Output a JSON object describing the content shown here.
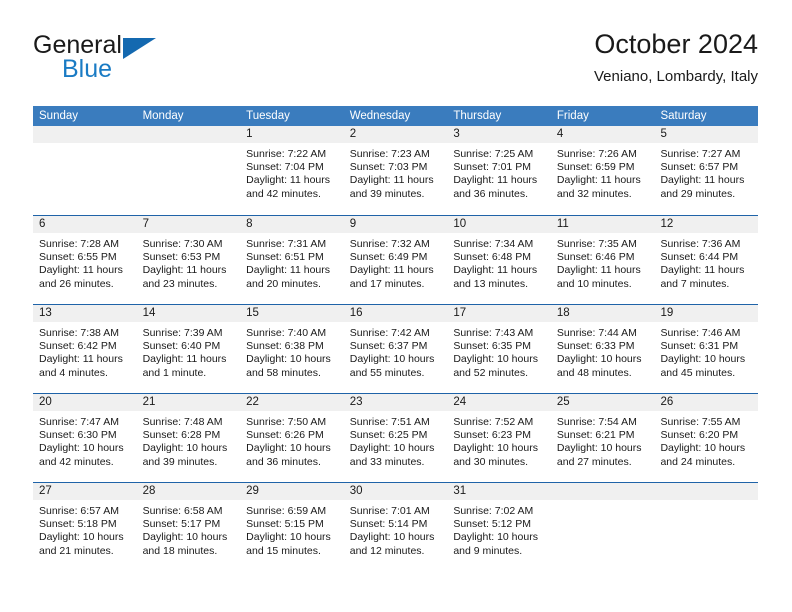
{
  "brand": {
    "name_part1": "General",
    "name_part2": "Blue",
    "accent_color": "#1a7bc4",
    "triangle_color": "#1469b0"
  },
  "header": {
    "title": "October 2024",
    "subtitle": "Veniano, Lombardy, Italy"
  },
  "calendar": {
    "header_bg": "#3a7cbe",
    "separator_color": "#1f63a8",
    "day_band_bg": "#f0f0f0",
    "weekdays": [
      "Sunday",
      "Monday",
      "Tuesday",
      "Wednesday",
      "Thursday",
      "Friday",
      "Saturday"
    ],
    "weeks": [
      [
        {
          "day": ""
        },
        {
          "day": ""
        },
        {
          "day": "1",
          "sunrise": "Sunrise: 7:22 AM",
          "sunset": "Sunset: 7:04 PM",
          "daylight": "Daylight: 11 hours and 42 minutes."
        },
        {
          "day": "2",
          "sunrise": "Sunrise: 7:23 AM",
          "sunset": "Sunset: 7:03 PM",
          "daylight": "Daylight: 11 hours and 39 minutes."
        },
        {
          "day": "3",
          "sunrise": "Sunrise: 7:25 AM",
          "sunset": "Sunset: 7:01 PM",
          "daylight": "Daylight: 11 hours and 36 minutes."
        },
        {
          "day": "4",
          "sunrise": "Sunrise: 7:26 AM",
          "sunset": "Sunset: 6:59 PM",
          "daylight": "Daylight: 11 hours and 32 minutes."
        },
        {
          "day": "5",
          "sunrise": "Sunrise: 7:27 AM",
          "sunset": "Sunset: 6:57 PM",
          "daylight": "Daylight: 11 hours and 29 minutes."
        }
      ],
      [
        {
          "day": "6",
          "sunrise": "Sunrise: 7:28 AM",
          "sunset": "Sunset: 6:55 PM",
          "daylight": "Daylight: 11 hours and 26 minutes."
        },
        {
          "day": "7",
          "sunrise": "Sunrise: 7:30 AM",
          "sunset": "Sunset: 6:53 PM",
          "daylight": "Daylight: 11 hours and 23 minutes."
        },
        {
          "day": "8",
          "sunrise": "Sunrise: 7:31 AM",
          "sunset": "Sunset: 6:51 PM",
          "daylight": "Daylight: 11 hours and 20 minutes."
        },
        {
          "day": "9",
          "sunrise": "Sunrise: 7:32 AM",
          "sunset": "Sunset: 6:49 PM",
          "daylight": "Daylight: 11 hours and 17 minutes."
        },
        {
          "day": "10",
          "sunrise": "Sunrise: 7:34 AM",
          "sunset": "Sunset: 6:48 PM",
          "daylight": "Daylight: 11 hours and 13 minutes."
        },
        {
          "day": "11",
          "sunrise": "Sunrise: 7:35 AM",
          "sunset": "Sunset: 6:46 PM",
          "daylight": "Daylight: 11 hours and 10 minutes."
        },
        {
          "day": "12",
          "sunrise": "Sunrise: 7:36 AM",
          "sunset": "Sunset: 6:44 PM",
          "daylight": "Daylight: 11 hours and 7 minutes."
        }
      ],
      [
        {
          "day": "13",
          "sunrise": "Sunrise: 7:38 AM",
          "sunset": "Sunset: 6:42 PM",
          "daylight": "Daylight: 11 hours and 4 minutes."
        },
        {
          "day": "14",
          "sunrise": "Sunrise: 7:39 AM",
          "sunset": "Sunset: 6:40 PM",
          "daylight": "Daylight: 11 hours and 1 minute."
        },
        {
          "day": "15",
          "sunrise": "Sunrise: 7:40 AM",
          "sunset": "Sunset: 6:38 PM",
          "daylight": "Daylight: 10 hours and 58 minutes."
        },
        {
          "day": "16",
          "sunrise": "Sunrise: 7:42 AM",
          "sunset": "Sunset: 6:37 PM",
          "daylight": "Daylight: 10 hours and 55 minutes."
        },
        {
          "day": "17",
          "sunrise": "Sunrise: 7:43 AM",
          "sunset": "Sunset: 6:35 PM",
          "daylight": "Daylight: 10 hours and 52 minutes."
        },
        {
          "day": "18",
          "sunrise": "Sunrise: 7:44 AM",
          "sunset": "Sunset: 6:33 PM",
          "daylight": "Daylight: 10 hours and 48 minutes."
        },
        {
          "day": "19",
          "sunrise": "Sunrise: 7:46 AM",
          "sunset": "Sunset: 6:31 PM",
          "daylight": "Daylight: 10 hours and 45 minutes."
        }
      ],
      [
        {
          "day": "20",
          "sunrise": "Sunrise: 7:47 AM",
          "sunset": "Sunset: 6:30 PM",
          "daylight": "Daylight: 10 hours and 42 minutes."
        },
        {
          "day": "21",
          "sunrise": "Sunrise: 7:48 AM",
          "sunset": "Sunset: 6:28 PM",
          "daylight": "Daylight: 10 hours and 39 minutes."
        },
        {
          "day": "22",
          "sunrise": "Sunrise: 7:50 AM",
          "sunset": "Sunset: 6:26 PM",
          "daylight": "Daylight: 10 hours and 36 minutes."
        },
        {
          "day": "23",
          "sunrise": "Sunrise: 7:51 AM",
          "sunset": "Sunset: 6:25 PM",
          "daylight": "Daylight: 10 hours and 33 minutes."
        },
        {
          "day": "24",
          "sunrise": "Sunrise: 7:52 AM",
          "sunset": "Sunset: 6:23 PM",
          "daylight": "Daylight: 10 hours and 30 minutes."
        },
        {
          "day": "25",
          "sunrise": "Sunrise: 7:54 AM",
          "sunset": "Sunset: 6:21 PM",
          "daylight": "Daylight: 10 hours and 27 minutes."
        },
        {
          "day": "26",
          "sunrise": "Sunrise: 7:55 AM",
          "sunset": "Sunset: 6:20 PM",
          "daylight": "Daylight: 10 hours and 24 minutes."
        }
      ],
      [
        {
          "day": "27",
          "sunrise": "Sunrise: 6:57 AM",
          "sunset": "Sunset: 5:18 PM",
          "daylight": "Daylight: 10 hours and 21 minutes."
        },
        {
          "day": "28",
          "sunrise": "Sunrise: 6:58 AM",
          "sunset": "Sunset: 5:17 PM",
          "daylight": "Daylight: 10 hours and 18 minutes."
        },
        {
          "day": "29",
          "sunrise": "Sunrise: 6:59 AM",
          "sunset": "Sunset: 5:15 PM",
          "daylight": "Daylight: 10 hours and 15 minutes."
        },
        {
          "day": "30",
          "sunrise": "Sunrise: 7:01 AM",
          "sunset": "Sunset: 5:14 PM",
          "daylight": "Daylight: 10 hours and 12 minutes."
        },
        {
          "day": "31",
          "sunrise": "Sunrise: 7:02 AM",
          "sunset": "Sunset: 5:12 PM",
          "daylight": "Daylight: 10 hours and 9 minutes."
        },
        {
          "day": ""
        },
        {
          "day": ""
        }
      ]
    ]
  }
}
